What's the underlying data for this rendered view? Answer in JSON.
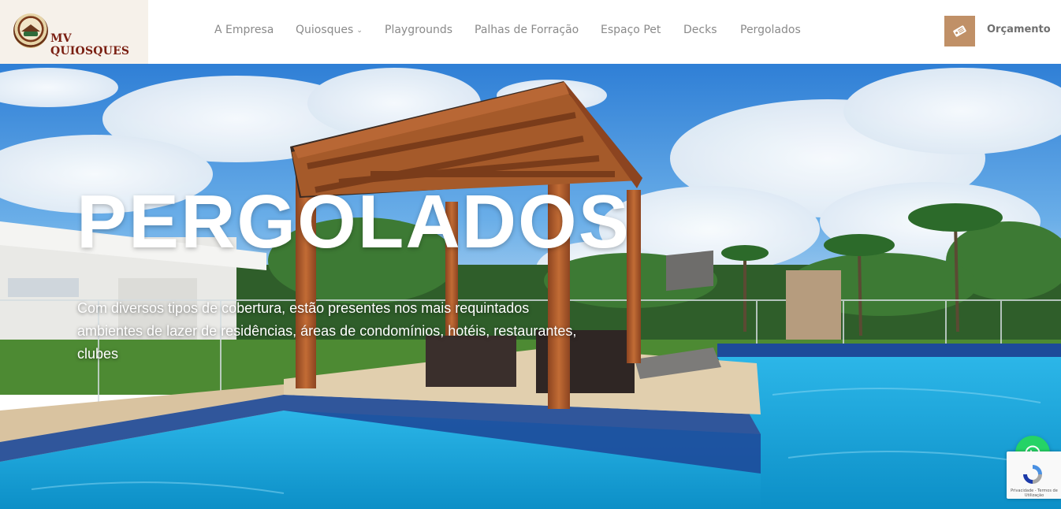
{
  "brand": {
    "name": "MV QUIOSQUES",
    "logo_icon": "kiosk-emblem"
  },
  "nav": {
    "items": [
      {
        "label": "A Empresa",
        "has_dropdown": false
      },
      {
        "label": "Quiosques",
        "has_dropdown": true
      },
      {
        "label": "Playgrounds",
        "has_dropdown": false
      },
      {
        "label": "Palhas de Forração",
        "has_dropdown": false
      },
      {
        "label": "Espaço Pet",
        "has_dropdown": false
      },
      {
        "label": "Decks",
        "has_dropdown": false
      },
      {
        "label": "Pergolados",
        "has_dropdown": false
      }
    ],
    "dropdown_glyph": "⌄"
  },
  "cta": {
    "label": "Orçamento",
    "icon": "price-tag-icon",
    "color": "#c09067"
  },
  "hero": {
    "title": "PERGOLADOS",
    "subtitle": "Com diversos tipos de cobertura, estão presentes nos mais requintados ambientes de lazer de residências, áreas de condomínios, hotéis, restaurantes, clubes"
  },
  "whatsapp": {
    "icon": "whatsapp-icon",
    "color": "#25d366"
  },
  "recaptcha": {
    "links": "Privacidade - Termos de Utilização"
  },
  "colors": {
    "nav_text": "#8a8a8a",
    "brand_text": "#7a1f12",
    "logo_bg": "#f6f1ea",
    "pool": "#1aa6d6",
    "wood": "#a55a2a"
  }
}
